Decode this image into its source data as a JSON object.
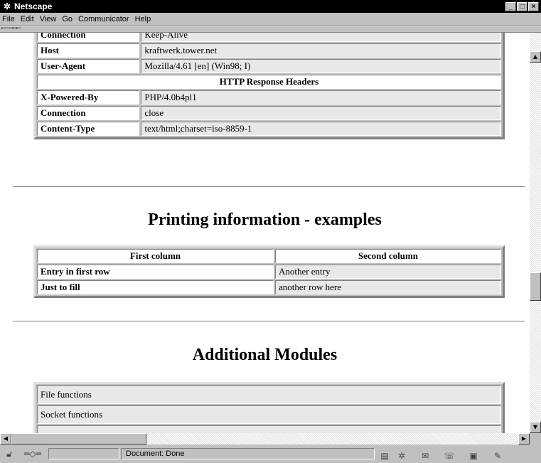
{
  "window": {
    "title": "Netscape",
    "minimize": "_",
    "maximize": "□",
    "close": "×"
  },
  "menu": [
    "File",
    "Edit",
    "View",
    "Go",
    "Communicator",
    "Help"
  ],
  "toolbar_grip": "▸▫▫▫▫▫▫▫▫▫▫▫▫▸▫▫▫▸▫▫▫",
  "request_headers": [
    {
      "key": "Connection",
      "value": "Keep-Alive"
    },
    {
      "key": "Host",
      "value": "kraftwerk.tower.net"
    },
    {
      "key": "User-Agent",
      "value": "Mozilla/4.61 [en] (Win98; I)"
    }
  ],
  "response_section": {
    "heading": "HTTP Response Headers",
    "rows": [
      {
        "key": "X-Powered-By",
        "value": "PHP/4.0b4pl1"
      },
      {
        "key": "Connection",
        "value": "close"
      },
      {
        "key": "Content-Type",
        "value": "text/html;charset=iso-8859-1"
      }
    ]
  },
  "printing": {
    "heading": "Printing information - examples",
    "columns": [
      "First column",
      "Second column"
    ],
    "rows": [
      {
        "first": "Entry in first row",
        "second": "Another entry"
      },
      {
        "first": "Just to fill",
        "second": "another row here"
      }
    ]
  },
  "modules": {
    "heading": "Additional Modules",
    "items": [
      "File functions",
      "Socket functions",
      ""
    ]
  },
  "status": {
    "text": "Document: Done"
  }
}
